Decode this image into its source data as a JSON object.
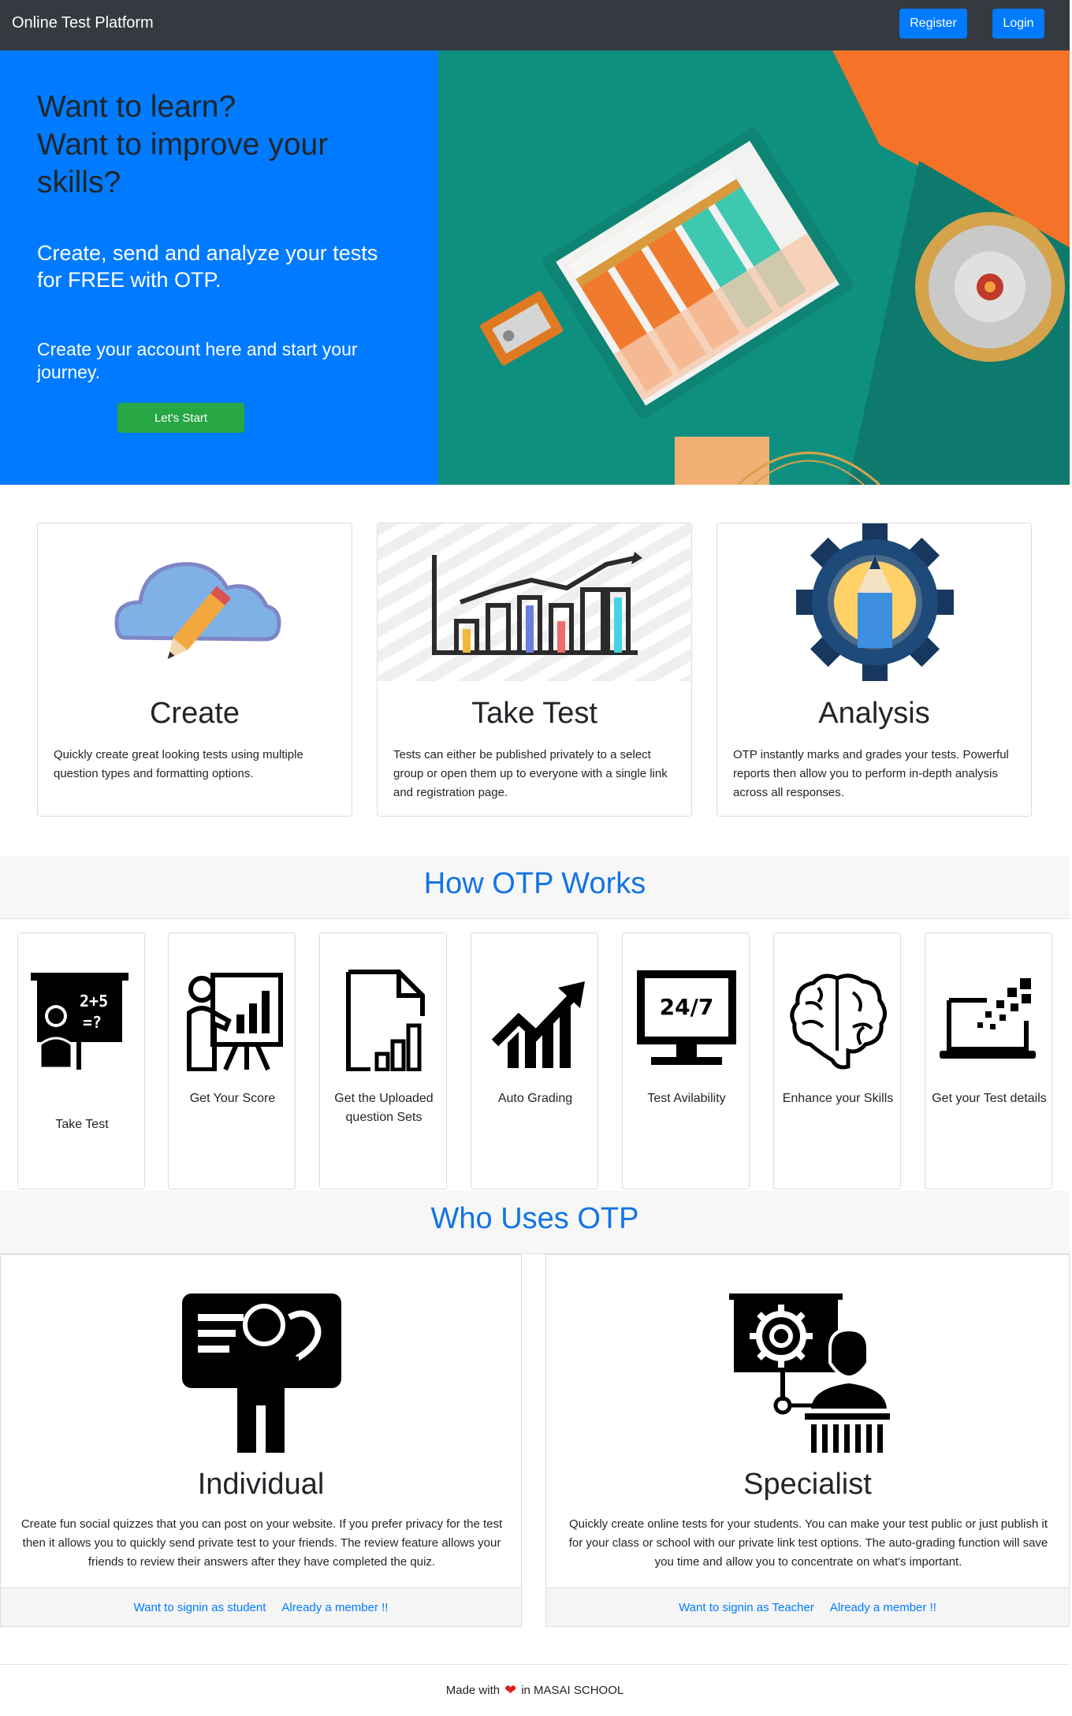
{
  "nav": {
    "brand": "Online Test Platform",
    "register_label": "Register",
    "login_label": "Login"
  },
  "hero": {
    "title_line1": "Want to learn?",
    "title_line2": "Want to improve your skills?",
    "subtitle_line1": "Create, send and analyze your tests",
    "subtitle_line2": "for FREE with OTP.",
    "subtitle2": "Create your account here and start your journey.",
    "cta_label": "Let's Start"
  },
  "features": [
    {
      "title": "Create",
      "icon": "cloud-pencil-icon",
      "text": "Quickly create great looking tests using multiple question types and formatting options."
    },
    {
      "title": "Take Test",
      "icon": "bar-chart-icon",
      "text": "Tests can either be published privately to a select group or open them up to everyone with a single link and registration page."
    },
    {
      "title": "Analysis",
      "icon": "gear-pencil-icon",
      "text": "OTP instantly marks and grades your tests. Powerful reports then allow you to perform in-depth analysis across all responses."
    }
  ],
  "how": {
    "heading": "How OTP Works",
    "steps": [
      {
        "label": "Take Test",
        "icon": "teacher-board-icon"
      },
      {
        "label": "Get Your Score",
        "icon": "presentation-icon"
      },
      {
        "label": "Get the Uploaded question Sets",
        "icon": "document-chart-icon"
      },
      {
        "label": "Auto Grading",
        "icon": "growth-chart-icon"
      },
      {
        "label": "Test Avilability",
        "icon": "monitor-24-7-icon"
      },
      {
        "label": "Enhance your Skills",
        "icon": "brain-icon"
      },
      {
        "label": "Get your Test details",
        "icon": "laptop-pixels-icon"
      }
    ]
  },
  "who": {
    "heading": "Who Uses OTP",
    "cards": [
      {
        "title": "Individual",
        "icon": "thinking-person-icon",
        "text": "Create fun social quizzes that you can post on your website. If you prefer privacy for the test then it allows you to quickly send private test to your friends. The review feature allows your friends to review their answers after they have completed the quiz.",
        "link1": "Want to signin as student",
        "link2": "Already a member !!"
      },
      {
        "title": "Specialist",
        "icon": "teacher-gear-icon",
        "text": "Quickly create online tests for your students. You can make your test public or just publish it for your class or school with our private link test options. The auto-grading function will save you time and allow you to concentrate on what's important.",
        "link1": "Want to signin as Teacher",
        "link2": "Already a member !!"
      }
    ]
  },
  "footer": {
    "made_with": "Made with",
    "heart": "❤",
    "place": "in MASAI SCHOOL"
  },
  "colors": {
    "primary": "#007bff",
    "success": "#28a745",
    "dark": "#343a40",
    "heading_blue": "#1273e6"
  }
}
